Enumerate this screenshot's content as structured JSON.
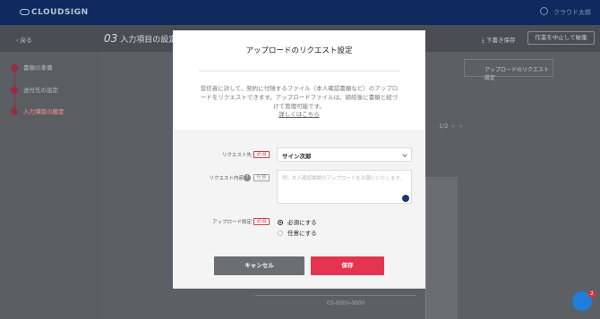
{
  "app": {
    "logo": "CLOUDSIGN",
    "user_name": "クラウド太郎"
  },
  "subbar": {
    "back_label": "戻る",
    "step_number": "03",
    "step_title": "入力項目の設定",
    "draft_save_label": "下書き保存",
    "stop_label": "作業を中止して破棄"
  },
  "sidebar": {
    "steps": [
      {
        "label": "書類の準備"
      },
      {
        "label": "送付先の設定"
      },
      {
        "label": "入力項目の設定"
      }
    ]
  },
  "main": {
    "right_tab_label": "アップロードのリクエスト設定",
    "pager": "1/2",
    "phone": "03-0000-0000"
  },
  "modal": {
    "title": "アップロードのリクエスト設定",
    "description": "受信者に対して、契約に付随するファイル（本人確認書類など）のアップロードをリクエストできます。アップロードファイルは、締結後に書類と紐づけて管理可能です。",
    "link_label": "詳しくはこちら",
    "fields": {
      "request_to_label": "リクエスト先",
      "request_to_tag": "必須",
      "request_to_value": "サイン次郎",
      "request_content_label": "リクエスト内容",
      "request_content_tag": "任意",
      "request_content_placeholder": "例）本人確認書類のアップロードをお願いいたします。",
      "upload_setting_label": "アップロード設定",
      "upload_setting_tag": "必須",
      "upload_options": [
        {
          "label": "必須にする",
          "selected": true
        },
        {
          "label": "任意にする",
          "selected": false
        }
      ]
    },
    "cancel_label": "キャンセル",
    "save_label": "保存"
  },
  "chat": {
    "badge": "2"
  },
  "colors": {
    "accent": "#e5344f",
    "navy": "#0e2a5e"
  }
}
